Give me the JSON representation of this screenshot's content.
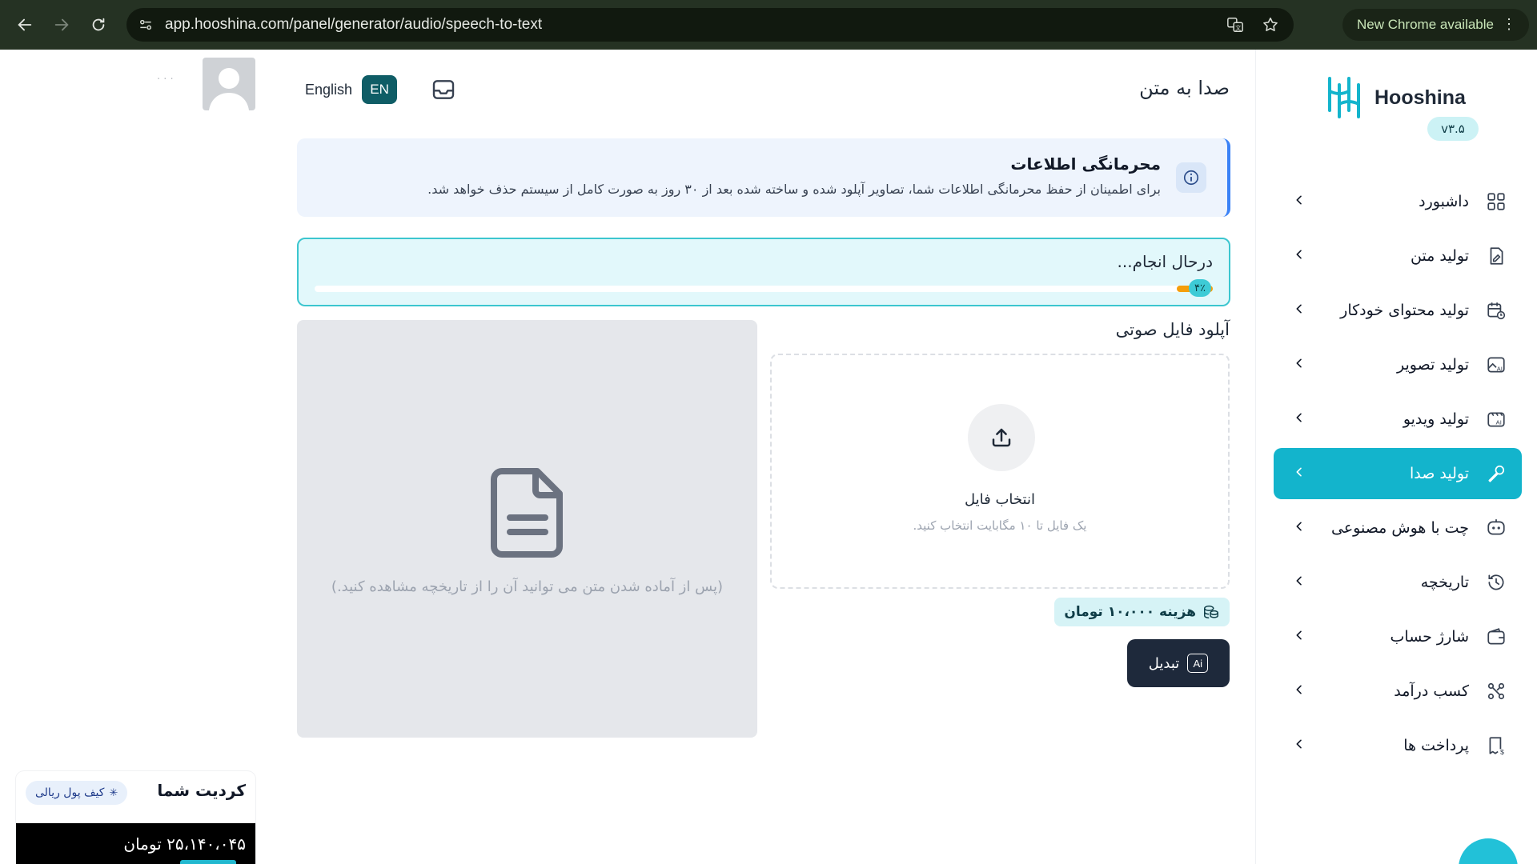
{
  "browser": {
    "url": "app.hooshina.com/panel/generator/audio/speech-to-text",
    "update_label": "New Chrome available"
  },
  "header": {
    "page_title": "صدا به متن",
    "language_label": "English",
    "language_code": "EN"
  },
  "privacy_alert": {
    "title": "محرمانگی اطلاعات",
    "text": "برای اطمینان از حفظ محرمانگی اطلاعات شما، تصاویر آپلود شده و ساخته شده بعد از ۳۰ روز به صورت کامل از سیستم حذف خواهد شد."
  },
  "progress": {
    "label": "درحال انجام...",
    "percent_label": "۴٪",
    "percent": 4
  },
  "upload": {
    "section_title": "آپلود فایل صوتی",
    "pick_label": "انتخاب فایل",
    "hint": "یک فایل تا ۱۰ مگابایت انتخاب کنید."
  },
  "preview": {
    "placeholder": "(پس از آماده شدن متن می توانید آن را از تاریخچه مشاهده کنید.)"
  },
  "cost": {
    "label": "هزینه ۱۰،۰۰۰ تومان"
  },
  "convert_button": {
    "label": "تبدیل",
    "ai_badge": "Ai"
  },
  "user": {
    "name": "· · ·"
  },
  "credit": {
    "title": "کردیت شما",
    "wallet_label": "کیف پول ریالی",
    "amount": "۲۵،۱۴۰،۰۴۵ تومان"
  },
  "sidebar": {
    "brand": "Hooshina",
    "version": "v۳.۵",
    "items": [
      {
        "label": "داشبورد",
        "icon": "dashboard-icon"
      },
      {
        "label": "تولید متن",
        "icon": "document-edit-icon"
      },
      {
        "label": "تولید محتوای خودکار",
        "icon": "calendar-clock-icon"
      },
      {
        "label": "تولید تصویر",
        "icon": "ai-image-icon"
      },
      {
        "label": "تولید ویدیو",
        "icon": "ai-video-icon"
      },
      {
        "label": "تولید صدا",
        "icon": "microphone-icon",
        "active": true
      },
      {
        "label": "چت با هوش مصنوعی",
        "icon": "ai-chat-icon"
      },
      {
        "label": "تاریخچه",
        "icon": "history-icon"
      },
      {
        "label": "شارژ حساب",
        "icon": "wallet-icon"
      },
      {
        "label": "کسب درآمد",
        "icon": "share-network-icon"
      },
      {
        "label": "پرداخت ها",
        "icon": "receipt-icon"
      }
    ]
  },
  "colors": {
    "accent": "#13b4cc",
    "brand_dark": "#0f5d66",
    "button_dark": "#1e293b",
    "info_blue": "#3b82f6"
  }
}
